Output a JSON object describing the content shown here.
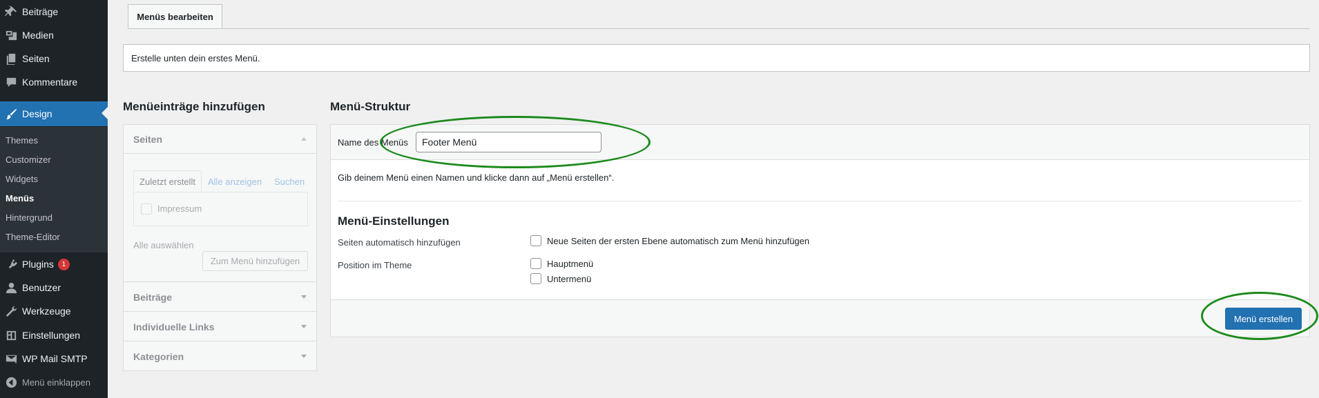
{
  "sidebar": {
    "items": [
      {
        "label": "Beiträge",
        "icon": "pin-icon"
      },
      {
        "label": "Medien",
        "icon": "media-icon"
      },
      {
        "label": "Seiten",
        "icon": "pages-icon"
      },
      {
        "label": "Kommentare",
        "icon": "comment-icon"
      },
      {
        "label": "Design",
        "icon": "brush-icon",
        "active": true
      },
      {
        "label": "Plugins",
        "icon": "plugin-icon",
        "badge": "1"
      },
      {
        "label": "Benutzer",
        "icon": "user-icon"
      },
      {
        "label": "Werkzeuge",
        "icon": "wrench-icon"
      },
      {
        "label": "Einstellungen",
        "icon": "settings-icon"
      },
      {
        "label": "WP Mail SMTP",
        "icon": "mail-icon"
      },
      {
        "label": "Menü einklappen",
        "icon": "collapse-icon"
      }
    ],
    "submenu": [
      "Themes",
      "Customizer",
      "Widgets",
      "Menüs",
      "Hintergrund",
      "Theme-Editor"
    ],
    "submenu_current": "Menüs"
  },
  "tab": {
    "label": "Menüs bearbeiten"
  },
  "notice": {
    "text": "Erstelle unten dein erstes Menü."
  },
  "add_items": {
    "title": "Menüeinträge hinzufügen",
    "pages": {
      "label": "Seiten",
      "tabs": [
        "Zuletzt erstellt",
        "Alle anzeigen",
        "Suchen"
      ],
      "items": [
        "Impressum"
      ],
      "select_all": "Alle auswählen",
      "add_button": "Zum Menü hinzufügen"
    },
    "sections": [
      "Beiträge",
      "Individuelle Links",
      "Kategorien"
    ]
  },
  "structure": {
    "title": "Menü-Struktur",
    "name_label": "Name des Menüs",
    "name_value": "Footer Menü",
    "hint": "Gib deinem Menü einen Namen und klicke dann auf „Menü erstellen“.",
    "settings_title": "Menü-Einstellungen",
    "auto_add_label": "Seiten automatisch hinzufügen",
    "auto_add_option": "Neue Seiten der ersten Ebene automatisch zum Menü hinzufügen",
    "position_label": "Position im Theme",
    "positions": [
      "Hauptmenü",
      "Untermenü"
    ],
    "create_button": "Menü erstellen"
  },
  "colors": {
    "accent": "#2271b1",
    "sidebar": "#1d2327",
    "annotation": "#1b8a1b",
    "badge": "#d63638"
  }
}
